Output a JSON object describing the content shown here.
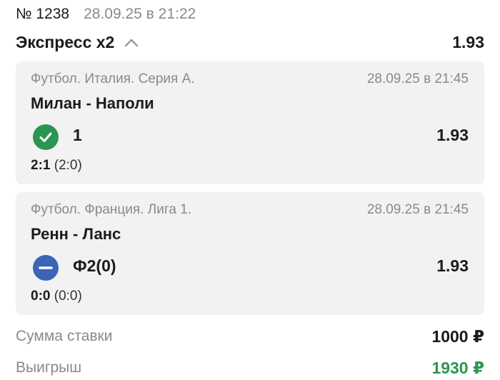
{
  "header": {
    "number": "№ 1238",
    "date": "28.09.25 в 21:22"
  },
  "express": {
    "title": "Экспресс х2",
    "toggle_icon": "chevron-up-icon",
    "coefficient": "1.93"
  },
  "events": [
    {
      "league": "Футбол. Италия. Серия А.",
      "date": "28.09.25 в 21:45",
      "teams": "Милан - Наполи",
      "status_icon": "check-circle-icon",
      "status_color": "#2b9651",
      "outcome": "1",
      "coefficient": "1.93",
      "score": "2:1",
      "half_score": "(2:0)"
    },
    {
      "league": "Футбол. Франция. Лига 1.",
      "date": "28.09.25 в 21:45",
      "teams": "Ренн - Ланс",
      "status_icon": "minus-circle-icon",
      "status_color": "#3b65b6",
      "outcome": "Ф2(0)",
      "coefficient": "1.93",
      "score": "0:0",
      "half_score": "(0:0)"
    }
  ],
  "summary": {
    "stake_label": "Сумма ставки",
    "stake_value": "1000 ₽",
    "win_label": "Выигрыш",
    "win_value": "1930 ₽",
    "win_color": "#2b9651"
  }
}
